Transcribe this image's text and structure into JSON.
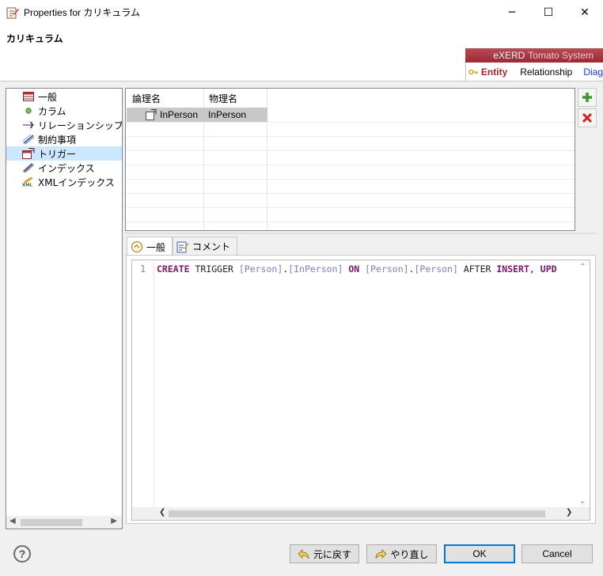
{
  "window": {
    "title": "Properties for カリキュラム",
    "controls": {
      "minimize": "─",
      "maximize": "☐",
      "close": "✕"
    }
  },
  "header": {
    "title": "カリキュラム",
    "banner": {
      "brand": "eXERD",
      "brand_sub": "Tomato System",
      "tabs": [
        "Entity",
        "Relationship",
        "Diag"
      ]
    }
  },
  "nav": {
    "items": [
      {
        "label": "一般",
        "icon": "table-icon"
      },
      {
        "label": "カラム",
        "icon": "column-dot-icon"
      },
      {
        "label": "リレーションシップ",
        "icon": "relationship-icon"
      },
      {
        "label": "制約事項",
        "icon": "constraint-icon"
      },
      {
        "label": "トリガー",
        "icon": "trigger-icon",
        "selected": true
      },
      {
        "label": "インデックス",
        "icon": "index-icon"
      },
      {
        "label": "XMLインデックス",
        "icon": "xml-index-icon"
      }
    ]
  },
  "trigger_table": {
    "columns": [
      "論理名",
      "物理名"
    ],
    "rows": [
      {
        "logical": "InPerson",
        "physical": "InPerson"
      }
    ]
  },
  "tabs": [
    {
      "label": "一般",
      "icon": "general-tab-icon",
      "active": true
    },
    {
      "label": "コメント",
      "icon": "comment-tab-icon",
      "active": false
    }
  ],
  "editor": {
    "line_number": "1",
    "tokens": [
      {
        "t": "CREATE",
        "c": "kw"
      },
      {
        "t": " TRIGGER ",
        "c": "plain"
      },
      {
        "t": "[Person]",
        "c": "ident"
      },
      {
        "t": ".",
        "c": "plain"
      },
      {
        "t": "[InPerson]",
        "c": "ident"
      },
      {
        "t": " ",
        "c": "plain"
      },
      {
        "t": "ON",
        "c": "kw"
      },
      {
        "t": " ",
        "c": "plain"
      },
      {
        "t": "[Person]",
        "c": "ident"
      },
      {
        "t": ".",
        "c": "plain"
      },
      {
        "t": "[Person]",
        "c": "ident"
      },
      {
        "t": " AFTER ",
        "c": "plain"
      },
      {
        "t": "INSERT",
        "c": "kw"
      },
      {
        "t": ", ",
        "c": "plain"
      },
      {
        "t": "UPD",
        "c": "kw"
      }
    ]
  },
  "buttons": {
    "undo": "元に戻す",
    "redo": "やり直し",
    "ok": "OK",
    "cancel": "Cancel",
    "help": "?"
  },
  "colors": {
    "accent": "#0078d7",
    "banner_red": "#9b2a33",
    "keyword": "#7a1670",
    "identifier": "#7a80c8",
    "selection": "#cce8ff"
  }
}
